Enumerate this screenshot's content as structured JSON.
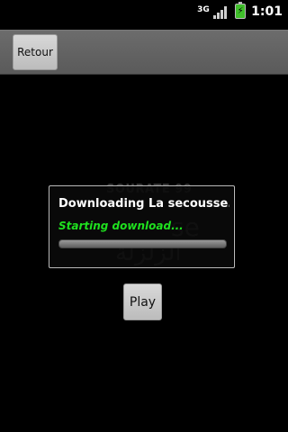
{
  "status_bar": {
    "network_label": "3G",
    "time": "1:01",
    "icons": [
      "network-3g-icon",
      "signal-icon",
      "battery-charging-icon"
    ]
  },
  "top_bar": {
    "back_label": "Retour"
  },
  "background": {
    "surah_title": "SOURATE 99",
    "latin_fragment": "se",
    "arabic_fragment": "الزلزلة"
  },
  "dialog": {
    "title": "Downloading La secousse...",
    "message": "Starting download...",
    "progress_fraction": 0
  },
  "controls": {
    "play_label": "Play"
  },
  "colors": {
    "background": "#000000",
    "message_color": "#1fe11f",
    "battery_color": "#3fbf2a"
  }
}
